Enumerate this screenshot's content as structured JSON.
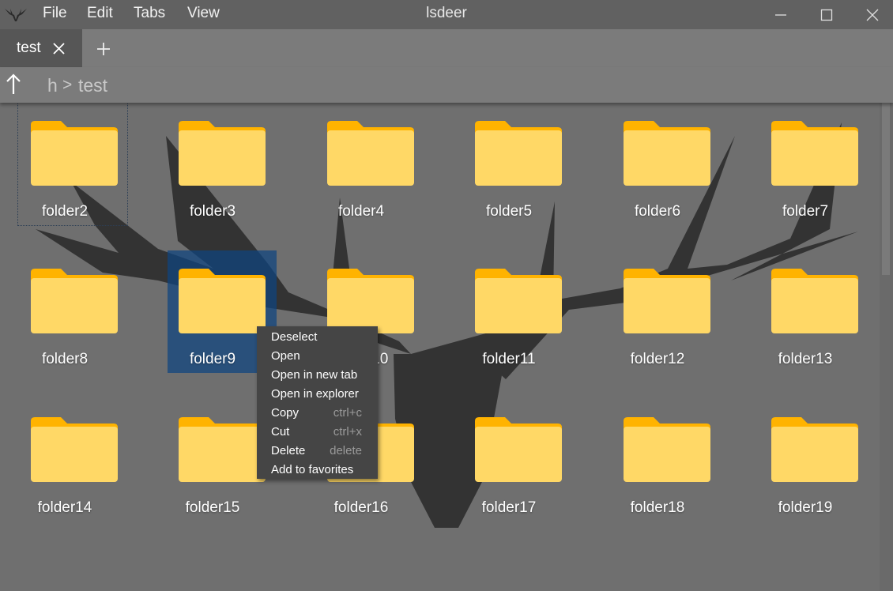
{
  "window": {
    "title": "lsdeer",
    "menu": [
      "File",
      "Edit",
      "Tabs",
      "View"
    ]
  },
  "tabs": [
    {
      "label": "test",
      "active": true
    }
  ],
  "address": {
    "breadcrumb": [
      "h",
      "test"
    ],
    "separator": ">"
  },
  "items": [
    "folder2",
    "folder3",
    "folder4",
    "folder5",
    "folder6",
    "folder7",
    "folder8",
    "folder9",
    "folder10",
    "folder11",
    "folder12",
    "folder13",
    "folder14",
    "folder15",
    "folder16",
    "folder17",
    "folder18",
    "folder19"
  ],
  "selected_item": "folder9",
  "focused_item": "folder2",
  "context_menu": [
    {
      "label": "Deselect",
      "shortcut": ""
    },
    {
      "label": "Open",
      "shortcut": ""
    },
    {
      "label": "Open in new tab",
      "shortcut": ""
    },
    {
      "label": "Open in explorer",
      "shortcut": ""
    },
    {
      "label": "Copy",
      "shortcut": "ctrl+c"
    },
    {
      "label": "Cut",
      "shortcut": "ctrl+x"
    },
    {
      "label": "Delete",
      "shortcut": "delete"
    },
    {
      "label": "Add to favorites",
      "shortcut": ""
    }
  ],
  "colors": {
    "folder_body": "#ffd866",
    "folder_tab": "#ffb300",
    "selection": "#0e4480",
    "background": "#6f6f6f",
    "logo": "#333333"
  }
}
